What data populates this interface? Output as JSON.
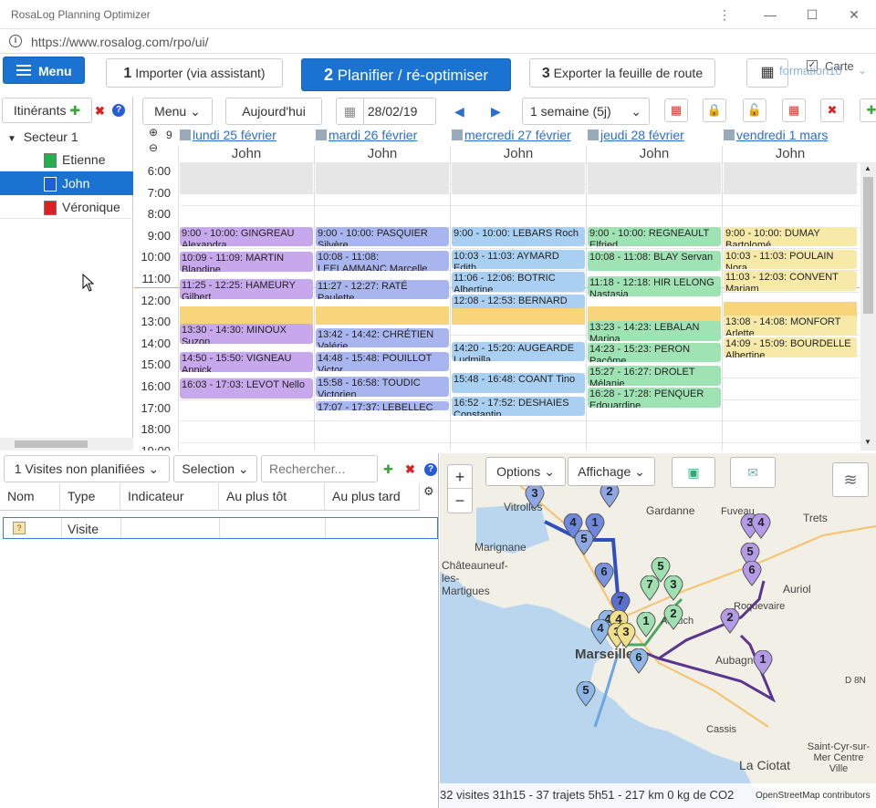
{
  "window": {
    "title": "RosaLog Planning Optimizer",
    "url": "https://www.rosalog.com/rpo/ui/"
  },
  "toolbar": {
    "menu_label": "Menu",
    "step1_num": "1",
    "step1_label": "Importer (via assistant)",
    "step2_num": "2",
    "step2_label": "Planifier / ré-optimiser",
    "step3_num": "3",
    "step3_label": "Exporter la feuille de route",
    "carte_label": "Carte",
    "user_label": "formation10"
  },
  "sidebar": {
    "header": "Itinérants",
    "sector": "Secteur 1",
    "items": [
      {
        "label": "Etienne",
        "color": "#22b14c"
      },
      {
        "label": "John",
        "color": "#1e5fd6"
      },
      {
        "label": "Véronique",
        "color": "#e02020"
      }
    ]
  },
  "calendar": {
    "menu_label": "Menu",
    "today_label": "Aujourd'hui",
    "date": "28/02/19",
    "range": "1 semaine (5j)",
    "zoom": "9",
    "hours": [
      "6:00",
      "7:00",
      "8:00",
      "9:00",
      "10:00",
      "11:00",
      "12:00",
      "13:00",
      "14:00",
      "15:00",
      "16:00",
      "17:00",
      "18:00",
      "19:00"
    ],
    "days": [
      {
        "label": "lundi 25 février",
        "person": "John"
      },
      {
        "label": "mardi 26 février",
        "person": "John"
      },
      {
        "label": "mercredi 27 février",
        "person": "John"
      },
      {
        "label": "jeudi 28 février",
        "person": "John"
      },
      {
        "label": "vendredi 1 mars",
        "person": "John"
      }
    ],
    "events": [
      [
        {
          "text": "9:00 - 10:00: GINGREAU Alexandra",
          "start": 9.0,
          "end": 10.0
        },
        {
          "text": "10:09 - 11:09: MARTIN Blandine",
          "start": 10.15,
          "end": 11.15
        },
        {
          "text": "11:25 - 12:25: HAMEURY Gilbert",
          "start": 11.42,
          "end": 12.42
        },
        {
          "text": "13:30 - 14:30: MINOUX Suzon",
          "start": 13.5,
          "end": 14.5
        },
        {
          "text": "14:50 - 15:50: VIGNEAU Annick",
          "start": 14.83,
          "end": 15.83
        },
        {
          "text": "16:03 - 17:03: LEVOT Nello",
          "start": 16.05,
          "end": 17.05
        }
      ],
      [
        {
          "text": "9:00 - 10:00: PASQUIER Silvère",
          "start": 9.0,
          "end": 10.0
        },
        {
          "text": "10:08 - 11:08: LEELAMMANC Marcelle",
          "start": 10.13,
          "end": 11.13
        },
        {
          "text": "11:27 - 12:27: RATÉ Paulette",
          "start": 11.45,
          "end": 12.45
        },
        {
          "text": "13:42 - 14:42: CHRÉTIEN Valérie",
          "start": 13.7,
          "end": 14.7
        },
        {
          "text": "14:48 - 15:48: POUILLOT Victor",
          "start": 14.8,
          "end": 15.8
        },
        {
          "text": "15:58 - 16:58: TOUDIC Victorien",
          "start": 15.97,
          "end": 16.97
        },
        {
          "text": "17:07 - 17:37: LEBELLEC",
          "start": 17.12,
          "end": 17.62
        }
      ],
      [
        {
          "text": "9:00 - 10:00: LEBARS Roch",
          "start": 9.0,
          "end": 10.0
        },
        {
          "text": "10:03 - 11:03: AYMARD Edith",
          "start": 10.05,
          "end": 11.05
        },
        {
          "text": "11:06 - 12:06: BOTRIC Albertine",
          "start": 11.1,
          "end": 12.1
        },
        {
          "text": "12:08 - 12:53: BERNARD",
          "start": 12.13,
          "end": 12.88
        },
        {
          "text": "14:20 - 15:20: AUGEARDE Ludmilla",
          "start": 14.33,
          "end": 15.33
        },
        {
          "text": "15:48 - 16:48: COANT Tino",
          "start": 15.8,
          "end": 16.8
        },
        {
          "text": "16:52 - 17:52: DESHAIES Constantin",
          "start": 16.87,
          "end": 17.87
        }
      ],
      [
        {
          "text": "9:00 - 10:00: REGNEAULT Elfried",
          "start": 9.0,
          "end": 10.0
        },
        {
          "text": "10:08 - 11:08: BLAY Servan",
          "start": 10.13,
          "end": 11.13
        },
        {
          "text": "11:18 - 12:18: HIR LELONG Nastasia",
          "start": 11.3,
          "end": 12.3
        },
        {
          "text": "13:23 - 14:23: LEBALAN Marina",
          "start": 13.38,
          "end": 14.38
        },
        {
          "text": "14:23 - 15:23: PERON Pacôme",
          "start": 14.38,
          "end": 15.38
        },
        {
          "text": "15:27 - 16:27: DROLET Mélanie",
          "start": 15.45,
          "end": 16.45
        },
        {
          "text": "16:28 - 17:28: PENQUER Edouardine",
          "start": 16.47,
          "end": 17.47
        }
      ],
      [
        {
          "text": "9:00 - 10:00: DUMAY Bartolomé",
          "start": 9.0,
          "end": 10.0
        },
        {
          "text": "10:03 - 11:03: POULAIN Nora",
          "start": 10.05,
          "end": 11.05
        },
        {
          "text": "11:03 - 12:03: CONVENT Mariam",
          "start": 11.05,
          "end": 12.05
        },
        {
          "text": "13:08 - 14:08: MONFORT Arlette",
          "start": 13.13,
          "end": 14.13
        },
        {
          "text": "14:09 - 15:09: BOURDELLE Albertine",
          "start": 14.15,
          "end": 15.15
        }
      ]
    ]
  },
  "unplanned": {
    "count_label": "1 Visites non planifiées",
    "selection_label": "Selection",
    "search_placeholder": "Rechercher...",
    "columns": [
      "Nom",
      "Type",
      "Indicateur",
      "Au plus tôt",
      "Au plus tard"
    ],
    "rows": [
      {
        "nom": "",
        "type": "Visite",
        "indicateur": "",
        "au_plus_tot": "",
        "au_plus_tard": ""
      }
    ]
  },
  "map": {
    "options_label": "Options",
    "affichage_label": "Affichage",
    "zoom_in": "+",
    "zoom_out": "−",
    "places": [
      "Vitrolles",
      "Gardanne",
      "Fuveau",
      "Trets",
      "Marignane",
      "Châteauneuf-les-Martigues",
      "Auriol",
      "Roquevaire",
      "Aubagne",
      "Marseille",
      "Allauch",
      "Cassis",
      "La Ciotat",
      "Saint-Cyr-sur-Mer Centre Ville",
      "D 8N"
    ],
    "status": "32 visites 31h15 -    37 trajets 5h51 - 217 km 0 kg de CO2",
    "attribution": "OpenStreetMap contributors"
  }
}
